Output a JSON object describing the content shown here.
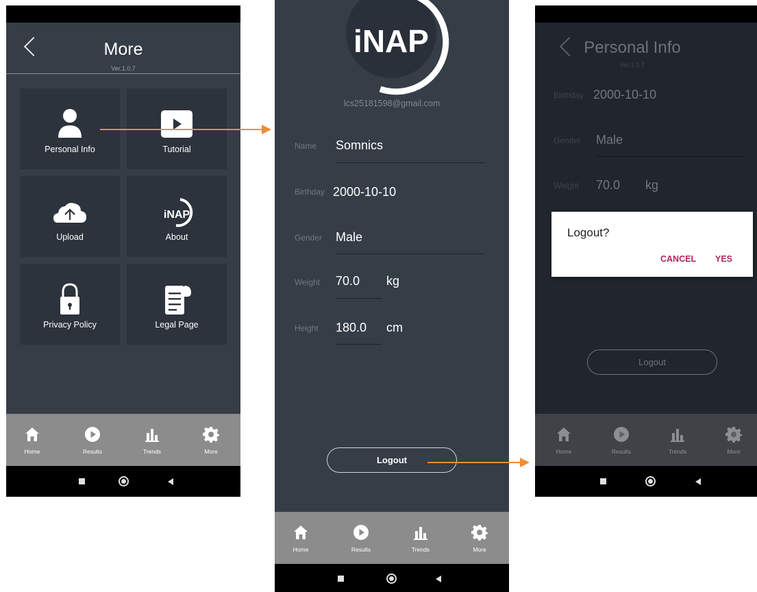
{
  "screen1": {
    "title": "More",
    "version": "Ver.1.0.7",
    "tiles": [
      {
        "label": "Personal Info",
        "icon": "person-icon"
      },
      {
        "label": "Tutorial",
        "icon": "play-video-icon"
      },
      {
        "label": "Upload",
        "icon": "cloud-upload-icon"
      },
      {
        "label": "About",
        "icon": "inap-logo-icon",
        "icon_text": "iNAP"
      },
      {
        "label": "Privacy Policy",
        "icon": "padlock-icon"
      },
      {
        "label": "Legal Page",
        "icon": "document-icon"
      }
    ]
  },
  "screen2": {
    "logo_text": "iNAP",
    "email": "lcs25181598@gmail.com",
    "fields": {
      "name": {
        "label": "Name",
        "value": "Somnics"
      },
      "birthday": {
        "label": "Birthday",
        "value": "2000-10-10"
      },
      "gender": {
        "label": "Gender",
        "value": "Male"
      },
      "weight": {
        "label": "Weight",
        "value": "70.0",
        "unit": "kg"
      },
      "height": {
        "label": "Height",
        "value": "180.0",
        "unit": "cm"
      }
    },
    "logout": "Logout"
  },
  "screen3": {
    "title": "Personal Info",
    "version": "Ver.1.0.7",
    "fields": {
      "birthday": {
        "label": "Birthday",
        "value": "2000-10-10"
      },
      "gender": {
        "label": "Gender",
        "value": "Male"
      },
      "weight": {
        "label": "Weight",
        "value": "70.0",
        "unit": "kg"
      }
    },
    "dialog": {
      "title": "Logout?",
      "cancel": "CANCEL",
      "yes": "YES"
    },
    "logout": "Logout"
  },
  "nav": {
    "home": "Home",
    "results": "Results",
    "trends": "Trends",
    "more": "More"
  },
  "colors": {
    "background": "#353d47",
    "tile": "#2c333c",
    "navbar": "#8c8c8c",
    "dialog_accent": "#b5245f",
    "arrow": "#f08c36"
  }
}
